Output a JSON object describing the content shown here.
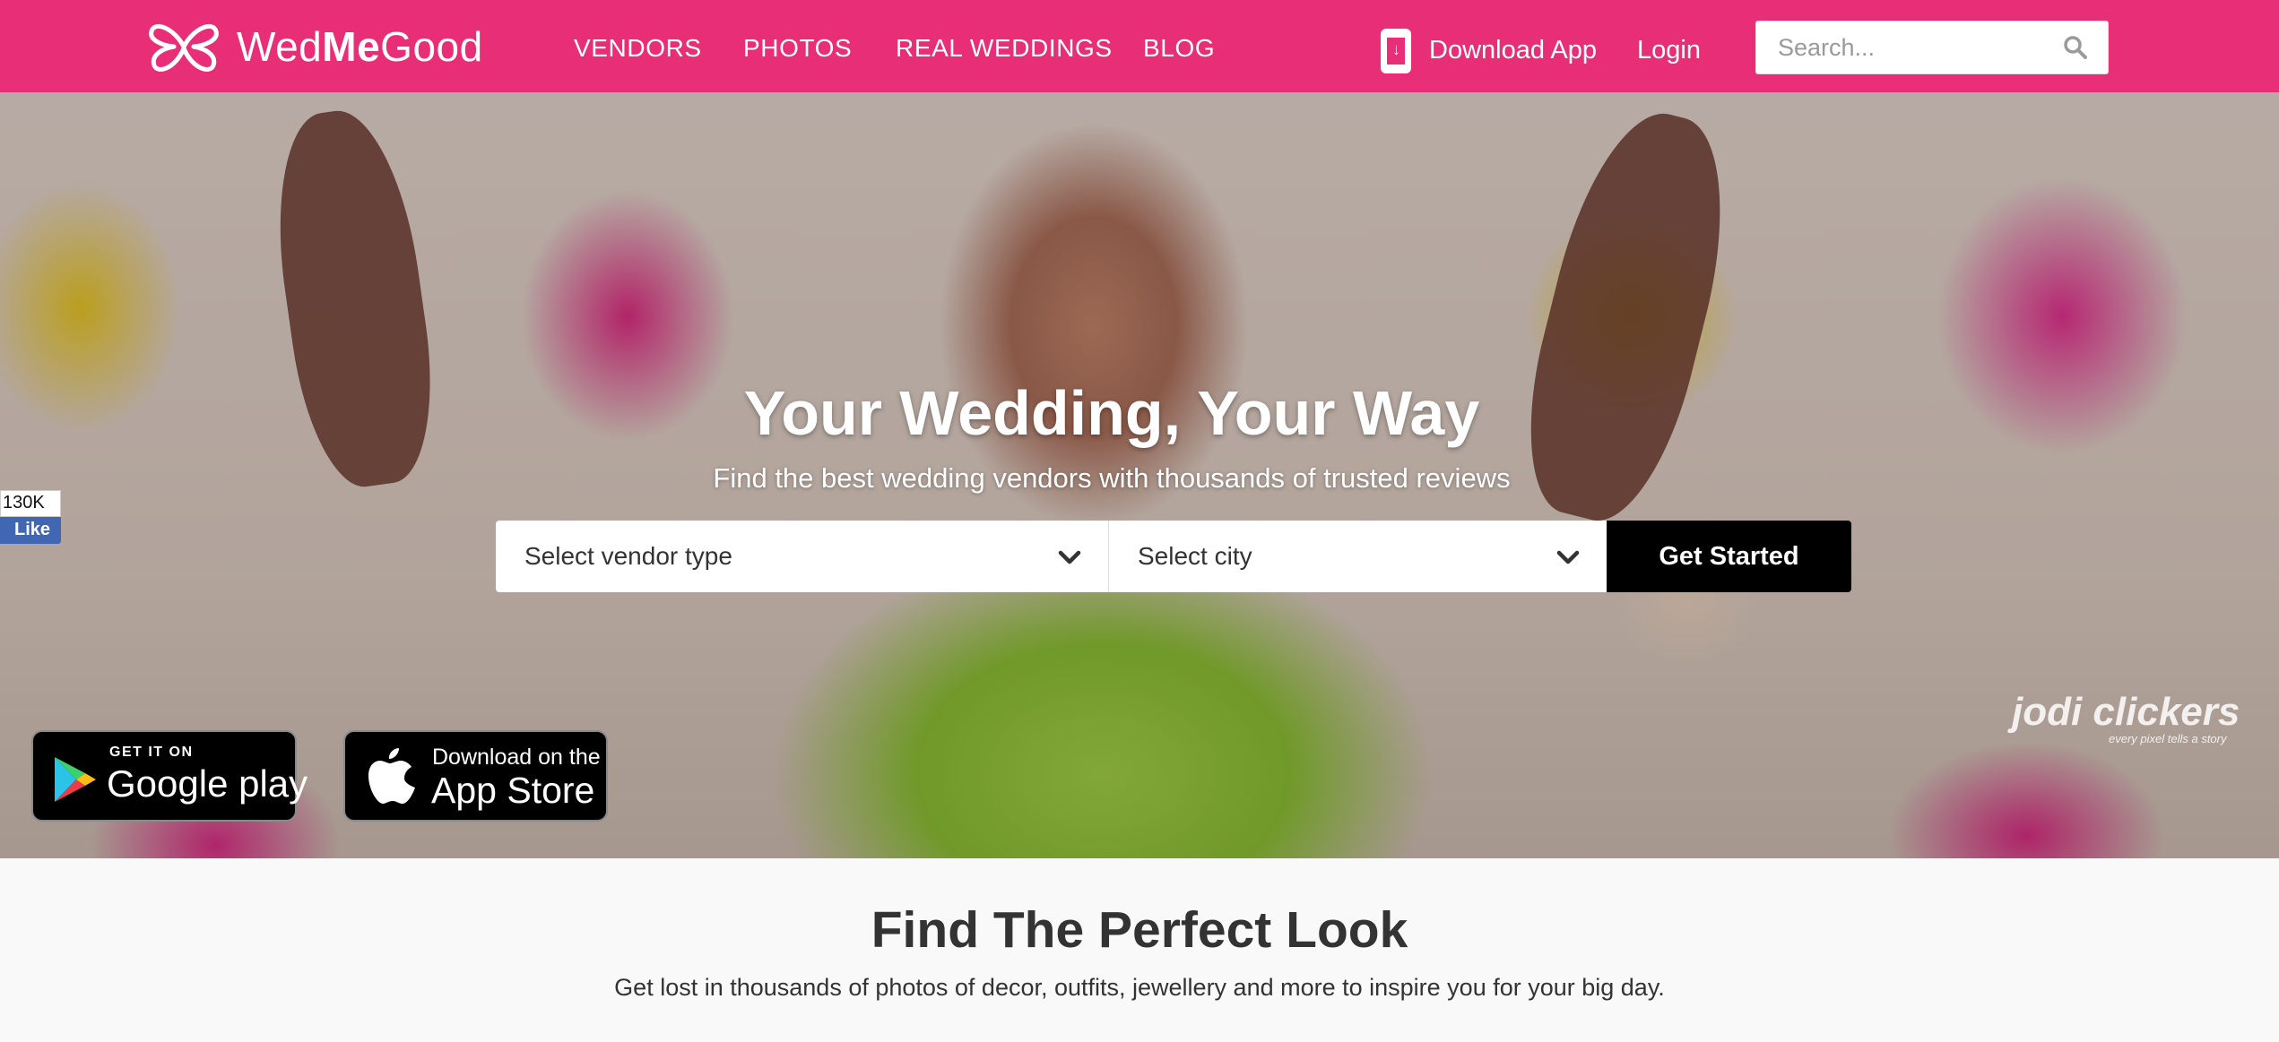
{
  "header": {
    "logo": {
      "prefix": "Wed",
      "bold": "Me",
      "suffix": "Good",
      "icon": "butterfly-logo-icon"
    },
    "nav": [
      {
        "label": "VENDORS"
      },
      {
        "label": "PHOTOS"
      },
      {
        "label": "REAL WEDDINGS"
      },
      {
        "label": "BLOG"
      }
    ],
    "download_app": {
      "label": "Download App",
      "icon": "phone-download-icon"
    },
    "login": {
      "label": "Login"
    },
    "search": {
      "placeholder": "Search...",
      "value": "",
      "icon": "search-icon"
    }
  },
  "hero": {
    "title": "Your Wedding, Your Way",
    "subtitle": "Find the best wedding vendors with thousands of trusted reviews",
    "vendor_select": {
      "value": "Select vendor type",
      "icon": "chevron-down-icon"
    },
    "city_select": {
      "value": "Select city",
      "icon": "chevron-down-icon"
    },
    "cta": "Get Started",
    "facebook": {
      "count": "130K",
      "like_label": "Like"
    },
    "google_play": {
      "small": "GET IT ON",
      "big": "Google play"
    },
    "app_store": {
      "small": "Download on the",
      "big": "App Store"
    },
    "watermark": {
      "name": "jodi clickers",
      "tagline": "every pixel tells a story"
    }
  },
  "section": {
    "title": "Find The Perfect Look",
    "subtitle": "Get lost in thousands of photos of decor, outfits, jewellery and more to inspire you for your big day."
  },
  "colors": {
    "brand": "#e72e77",
    "cta": "#000000",
    "facebook": "#4267b2"
  }
}
